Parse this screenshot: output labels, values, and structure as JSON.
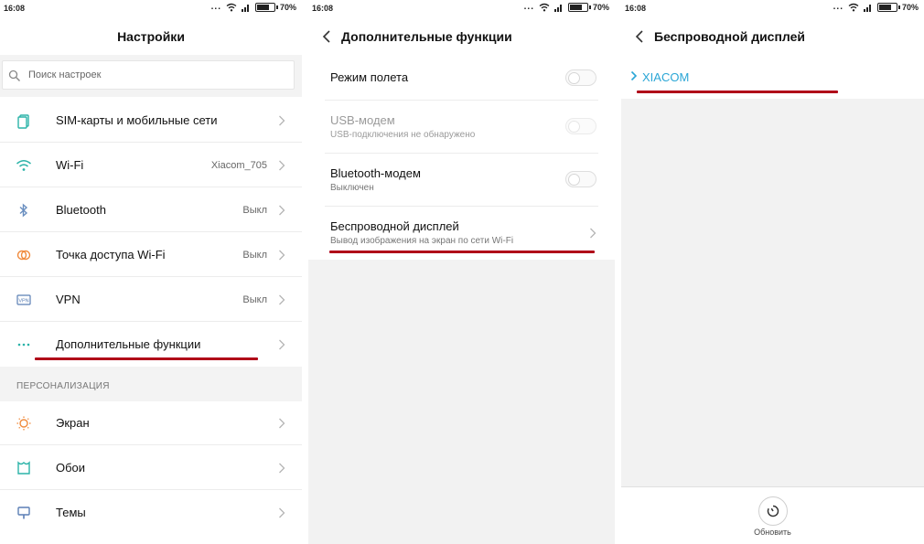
{
  "status_bar": {
    "time": "16:08",
    "dots": "...",
    "battery": "70%",
    "battery_level": 0.7
  },
  "screen1": {
    "title": "Настройки",
    "search": {
      "placeholder": "Поиск настроек",
      "value": ""
    },
    "items": [
      {
        "label": "SIM-карты и мобильные сети",
        "value": "",
        "icon": "sim-icon"
      },
      {
        "label": "Wi-Fi",
        "value": "Xiacom_705",
        "icon": "wifi-icon"
      },
      {
        "label": "Bluetooth",
        "value": "Выкл",
        "icon": "bluetooth-icon"
      },
      {
        "label": "Точка доступа Wi-Fi",
        "value": "Выкл",
        "icon": "hotspot-icon"
      },
      {
        "label": "VPN",
        "value": "Выкл",
        "icon": "vpn-icon"
      },
      {
        "label": "Дополнительные функции",
        "value": "",
        "icon": "more-dots-icon"
      }
    ],
    "section_title": "ПЕРСОНАЛИЗАЦИЯ",
    "personalization": [
      {
        "label": "Экран",
        "icon": "screen-icon"
      },
      {
        "label": "Обои",
        "icon": "wallpaper-icon"
      },
      {
        "label": "Темы",
        "icon": "themes-icon"
      }
    ]
  },
  "screen2": {
    "title": "Дополнительные функции",
    "options": [
      {
        "title": "Режим полета",
        "subtitle": "",
        "toggle": false,
        "enabled": true
      },
      {
        "title": "USB-модем",
        "subtitle": "USB-подключения не обнаружено",
        "toggle": false,
        "enabled": false
      },
      {
        "title": "Bluetooth-модем",
        "subtitle": "Выключен",
        "toggle": false,
        "enabled": true
      },
      {
        "title": "Беспроводной дисплей",
        "subtitle": "Вывод изображения на экран по сети Wi-Fi",
        "enabled": true
      }
    ]
  },
  "screen3": {
    "title": "Беспроводной дисплей",
    "device": "XIACOM",
    "refresh_label": "Обновить"
  },
  "colors": {
    "accent": "#2aa6d6",
    "highlight_underline": "#b00018",
    "icon_teal": "#2bb3a8",
    "icon_orange": "#f08a3c"
  }
}
